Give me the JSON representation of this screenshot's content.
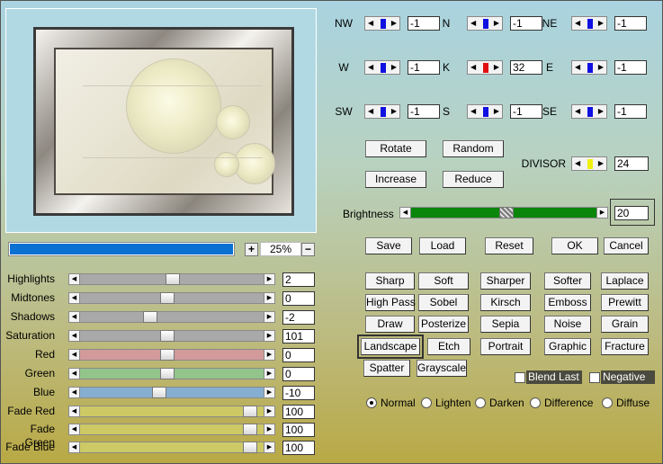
{
  "zoom": {
    "value": "25%",
    "plus": "+",
    "minus": "−",
    "progress": 1.0
  },
  "sliders": [
    {
      "label": "Highlights",
      "value": "2",
      "pos": 0.5
    },
    {
      "label": "Midtones",
      "value": "0",
      "pos": 0.47
    },
    {
      "label": "Shadows",
      "value": "-2",
      "pos": 0.37
    },
    {
      "label": "Saturation",
      "value": "101",
      "pos": 0.47
    },
    {
      "label": "Red",
      "value": "0",
      "pos": 0.47
    },
    {
      "label": "Green",
      "value": "0",
      "pos": 0.47
    },
    {
      "label": "Blue",
      "value": "-10",
      "pos": 0.42
    },
    {
      "label": "Fade Red",
      "value": "100",
      "pos": 0.95
    },
    {
      "label": "Fade Green",
      "value": "100",
      "pos": 0.95
    },
    {
      "label": "Fade Blue",
      "value": "100",
      "pos": 0.95
    }
  ],
  "slider_colors": [
    "#a9a9a9",
    "#a9a9a9",
    "#a9a9a9",
    "#a9a9a9",
    "#d29a9a",
    "#92c48c",
    "#86aed0",
    "#cdc965",
    "#cdc965",
    "#cdc965"
  ],
  "kernel": [
    {
      "label": "NW",
      "value": "-1"
    },
    {
      "label": "N",
      "value": "-1"
    },
    {
      "label": "NE",
      "value": "-1"
    },
    {
      "label": "W",
      "value": "-1"
    },
    {
      "label": "K",
      "value": "32"
    },
    {
      "label": "E",
      "value": "-1"
    },
    {
      "label": "SW",
      "value": "-1"
    },
    {
      "label": "S",
      "value": "-1"
    },
    {
      "label": "SE",
      "value": "-1"
    }
  ],
  "kernel_colors": {
    "normal": "#1010e0",
    "center": "#e01010",
    "divisor": "#f0f010"
  },
  "ops": {
    "rotate": "Rotate",
    "random": "Random",
    "increase": "Increase",
    "reduce": "Reduce"
  },
  "divisor": {
    "label": "DIVISOR",
    "value": "24"
  },
  "brightness": {
    "label": "Brightness",
    "value": "20",
    "pos": 0.53
  },
  "actions": {
    "save": "Save",
    "load": "Load",
    "reset": "Reset",
    "ok": "OK",
    "cancel": "Cancel"
  },
  "presets": [
    [
      "Sharp",
      "Soft",
      "Sharper",
      "Softer",
      "Laplace"
    ],
    [
      "High Pass",
      "Sobel",
      "Kirsch",
      "Emboss",
      "Prewitt"
    ],
    [
      "Draw",
      "Posterize",
      "Sepia",
      "Noise",
      "Grain"
    ],
    [
      "Landscape",
      "Etch",
      "Portrait",
      "Graphic",
      "Fracture"
    ],
    [
      "Spatter",
      "Grayscale"
    ]
  ],
  "checks": {
    "blend_last": "Blend Last",
    "negative": "Negative"
  },
  "modes": [
    "Normal",
    "Lighten",
    "Darken",
    "Difference",
    "Diffuse"
  ],
  "selected_mode": "Normal",
  "selected_preset": "Landscape"
}
